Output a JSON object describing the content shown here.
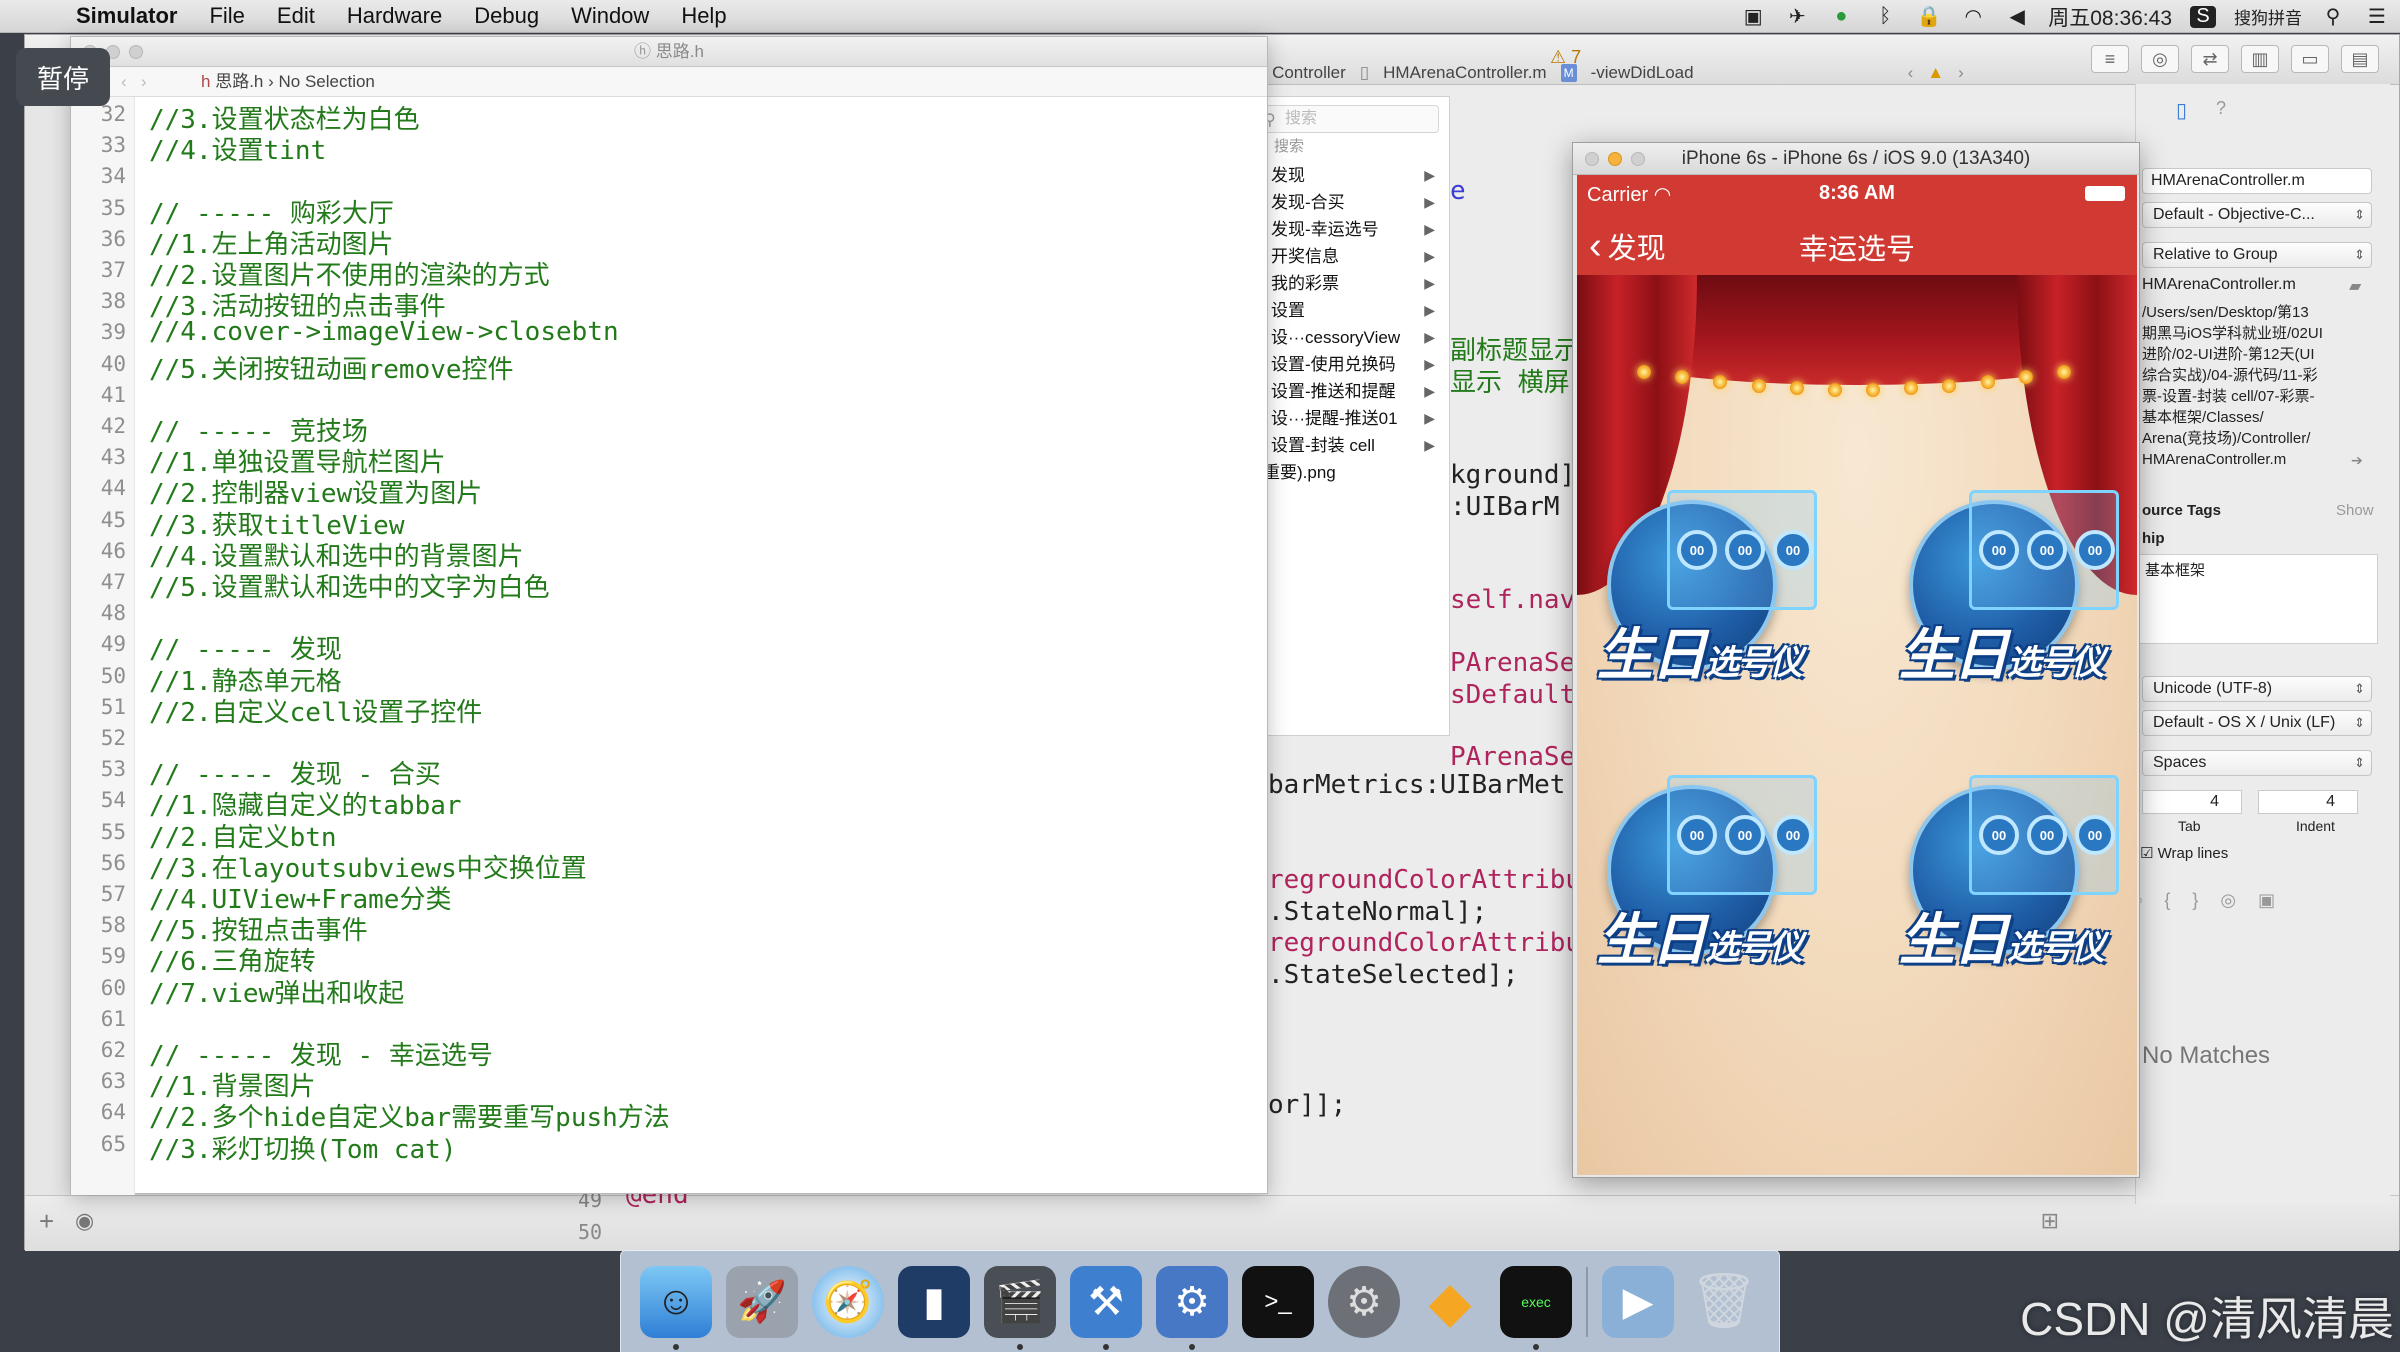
{
  "menubar": {
    "app_name": "Simulator",
    "items": [
      "File",
      "Edit",
      "Hardware",
      "Debug",
      "Window",
      "Help"
    ],
    "clock": "周五08:36:43",
    "input_method": "搜狗拼音"
  },
  "pause_badge": "暂停",
  "toolbar": {
    "warning_count": "⚠ 7"
  },
  "jump_bar": {
    "controller": "Controller",
    "file": "HMArenaController.m",
    "method_badge": "M",
    "method": "-viewDidLoad"
  },
  "code_window": {
    "title": "思路.h",
    "jump_file": "思路.h",
    "jump_selection": "No Selection",
    "lines": [
      {
        "n": "32",
        "text": "//3.设置状态栏为白色"
      },
      {
        "n": "33",
        "text": "//4.设置tint"
      },
      {
        "n": "34",
        "text": ""
      },
      {
        "n": "35",
        "text": "// ----- 购彩大厅"
      },
      {
        "n": "36",
        "text": "//1.左上角活动图片"
      },
      {
        "n": "37",
        "text": "//2.设置图片不使用的渲染的方式"
      },
      {
        "n": "38",
        "text": "//3.活动按钮的点击事件"
      },
      {
        "n": "39",
        "text": "//4.cover->imageView->closebtn"
      },
      {
        "n": "40",
        "text": "//5.关闭按钮动画remove控件"
      },
      {
        "n": "41",
        "text": ""
      },
      {
        "n": "42",
        "text": "// ----- 竞技场"
      },
      {
        "n": "43",
        "text": "//1.单独设置导航栏图片"
      },
      {
        "n": "44",
        "text": "//2.控制器view设置为图片"
      },
      {
        "n": "45",
        "text": "//3.获取titleView"
      },
      {
        "n": "46",
        "text": "//4.设置默认和选中的背景图片"
      },
      {
        "n": "47",
        "text": "//5.设置默认和选中的文字为白色"
      },
      {
        "n": "48",
        "text": ""
      },
      {
        "n": "49",
        "text": "// ----- 发现"
      },
      {
        "n": "50",
        "text": "//1.静态单元格"
      },
      {
        "n": "51",
        "text": "//2.自定义cell设置子控件"
      },
      {
        "n": "52",
        "text": ""
      },
      {
        "n": "53",
        "text": "// ----- 发现 - 合买"
      },
      {
        "n": "54",
        "text": "//1.隐藏自定义的tabbar"
      },
      {
        "n": "55",
        "text": "//2.自定义btn"
      },
      {
        "n": "56",
        "text": "//3.在layoutsubviews中交换位置"
      },
      {
        "n": "57",
        "text": "//4.UIView+Frame分类"
      },
      {
        "n": "58",
        "text": "//5.按钮点击事件"
      },
      {
        "n": "59",
        "text": "//6.三角旋转"
      },
      {
        "n": "60",
        "text": "//7.view弹出和收起"
      },
      {
        "n": "61",
        "text": ""
      },
      {
        "n": "62",
        "text": "// ----- 发现 - 幸运选号"
      },
      {
        "n": "63",
        "text": "//1.背景图片"
      },
      {
        "n": "64",
        "text": "//2.多个hide自定义bar需要重写push方法"
      },
      {
        "n": "65",
        "text": "//3.彩灯切换(Tom cat)"
      }
    ]
  },
  "file_list": {
    "search_placeholder": "搜索",
    "search_label": "搜索",
    "items": [
      "发现",
      "发现-合买",
      "发现-幸运选号",
      "开奖信息",
      "我的彩票",
      "设置",
      "设···cessoryView",
      "设置-使用兑换码",
      "设置-推送和提醒",
      "设···提醒-推送01",
      "设置-封装 cell",
      "常重要).png"
    ]
  },
  "bg_code": {
    "e1": "e",
    "l_title": "副标题显示",
    "l_show": "显示  横屏",
    "l_bg": "kground]",
    "l_bar": ":UIBarM",
    "l_self": "self.nav",
    "l_arena1": "PArenaSe",
    "l_default": "sDefault",
    "l_arena2": "PArenaSe",
    "l_metrics": "barMetrics:UIBarMet",
    "l_fg1": "regroundColorAttribu",
    "l_normal": ".StateNormal];",
    "l_fg2": "regroundColorAttribu",
    "l_selected": ".StateSelected];",
    "l_or": "or]];",
    "end_kw": "@end",
    "ln49": "49",
    "ln50": "50"
  },
  "simulator": {
    "title": "iPhone 6s - iPhone 6s / iOS 9.0 (13A340)",
    "carrier": "Carrier",
    "time": "8:36 AM",
    "back_label": "发现",
    "nav_title": "幸运选号",
    "tiles": [
      {
        "title": "生日",
        "sub": "选号仪",
        "dials": [
          "00",
          "00",
          "00"
        ]
      },
      {
        "title": "生日",
        "sub": "选号仪",
        "dials": [
          "00",
          "00",
          "00"
        ]
      },
      {
        "title": "生日",
        "sub": "选号仪",
        "dials": [
          "00",
          "00",
          "00"
        ]
      },
      {
        "title": "生日",
        "sub": "选号仪",
        "dials": [
          "00",
          "00",
          "00"
        ]
      }
    ]
  },
  "inspector": {
    "file_name": "HMArenaController.m",
    "file_type": "Default - Objective-C...",
    "location": "Relative to Group",
    "location_file": "HMArenaController.m",
    "full_path": [
      "/Users/sen/Desktop/第13",
      "期黑马iOS学科就业班/02UI",
      "进阶/02-UI进阶-第12天(UI",
      "综合实战)/04-源代码/11-彩",
      "票-设置-封装 cell/07-彩票-",
      "基本框架/Classes/",
      "Arena(竞技场)/Controller/",
      "HMArenaController.m"
    ],
    "source_tags_label": "ource Tags",
    "show_label": "Show",
    "membership_label": "hip",
    "target_name": "基本框架",
    "encoding": "Unicode (UTF-8)",
    "line_endings": "Default - OS X / Unix (LF)",
    "indent_using": "Spaces",
    "tab_width": "4",
    "indent_width": "4",
    "tab_label": "Tab",
    "indent_label": "Indent",
    "wrap_lines": "Wrap lines",
    "no_matches": "No Matches"
  },
  "dock": {
    "apps": [
      "finder-icon",
      "launchpad-icon",
      "safari-icon",
      "mouse-icon",
      "photo-slideshow-icon",
      "xcode-icon",
      "instruments-icon",
      "terminal-icon",
      "system-preferences-icon",
      "sketch-icon",
      "console-exec-icon",
      "screen-recorder-icon",
      "trash-icon"
    ]
  },
  "watermark": "CSDN @清风清晨"
}
